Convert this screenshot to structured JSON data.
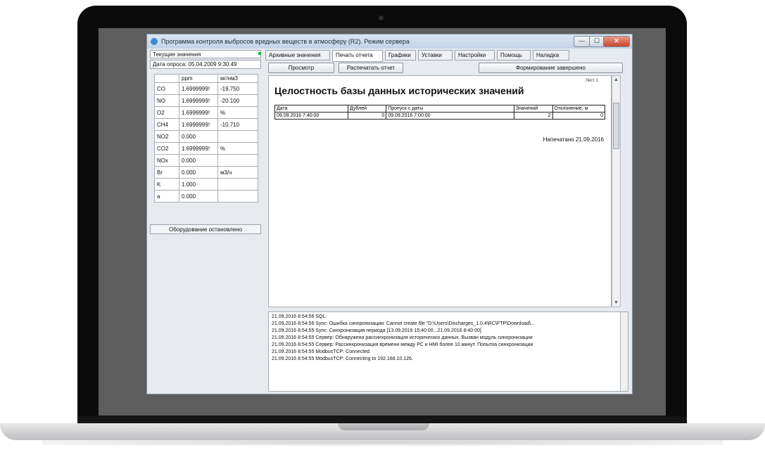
{
  "window": {
    "title": "Программа контроля выбросов вредных веществ в атмосферу (R2). Режим сервера",
    "min_symbol": "—",
    "max_symbol": "☐",
    "close_symbol": "✕"
  },
  "left_panel": {
    "header": "Текущие значения",
    "poll_date": "Дата опроса: 05.04.2009 9:30:49",
    "columns": [
      "",
      "ppm",
      "мг/нм3"
    ],
    "rows": [
      {
        "name": "CO",
        "ppm": "1.6999999!",
        "mg": "-19.750"
      },
      {
        "name": "NO",
        "ppm": "1.6999999!",
        "mg": "-20.100"
      },
      {
        "name": "O2",
        "ppm": "1.6999999!",
        "mg": "%"
      },
      {
        "name": "CH4",
        "ppm": "1.6999999!",
        "mg": "-10.710"
      },
      {
        "name": "NO2",
        "ppm": "0.000",
        "mg": ""
      },
      {
        "name": "CO2",
        "ppm": "1.6999999!",
        "mg": "%"
      },
      {
        "name": "NOx",
        "ppm": "0.000",
        "mg": ""
      },
      {
        "name": "Вг",
        "ppm": "0.000",
        "mg": "м3/ч"
      },
      {
        "name": "K",
        "ppm": "1.000",
        "mg": ""
      },
      {
        "name": "a",
        "ppm": "0.000",
        "mg": ""
      }
    ],
    "status": "Оборудование остановлено"
  },
  "tabs": [
    "Архивные значения",
    "Печать отчета",
    "Графики",
    "Уставки",
    "Настройки",
    "Помощь",
    "Наладка"
  ],
  "active_tab": "Печать отчета",
  "toolbar": {
    "preview": "Просмотр",
    "print": "Распечатать отчет",
    "status": "Формирование завершено"
  },
  "report": {
    "page": "Лист 1",
    "title": "Целостность базы данных исторических значений",
    "columns": [
      "Дата",
      "Дублей",
      "Пропуск с даты",
      "Значений",
      "Отклонение, м"
    ],
    "rows": [
      [
        "09.09.2016 7:40:00",
        "0",
        "09.09.2016 7:00:00",
        "2",
        "0"
      ]
    ],
    "printed": "Напечатано 21.09.2016"
  },
  "log": [
    "21.09.2016 8:54:56 SQL:",
    "21.09.2016 8:54:56 Sync: Ошибка синхронизации: Cannot create file \"D:\\Users\\Discharges_1.0.4\\RC\\FTP\\Download\\...",
    "21.09.2016 8:54:55 Sync: Синхронизация периода [13.09.2016 15:40:00...21.09.2016 8:40:00]",
    "21.09.2016 8:54:55 Сервер: Обнаружена рассинхронизация исторических данных. Вызван модуль синхронизации",
    "21.09.2016 8:54:55 Сервер: Рассинхронизация времени между PC и HMI более 10 минут. Попытка синхронизации",
    "21.09.2016 8:54:55 ModbusTCP: Connected.",
    "21.09.2016 8:54:55 ModbusTCP: Connecting to 192.168.10.126."
  ]
}
